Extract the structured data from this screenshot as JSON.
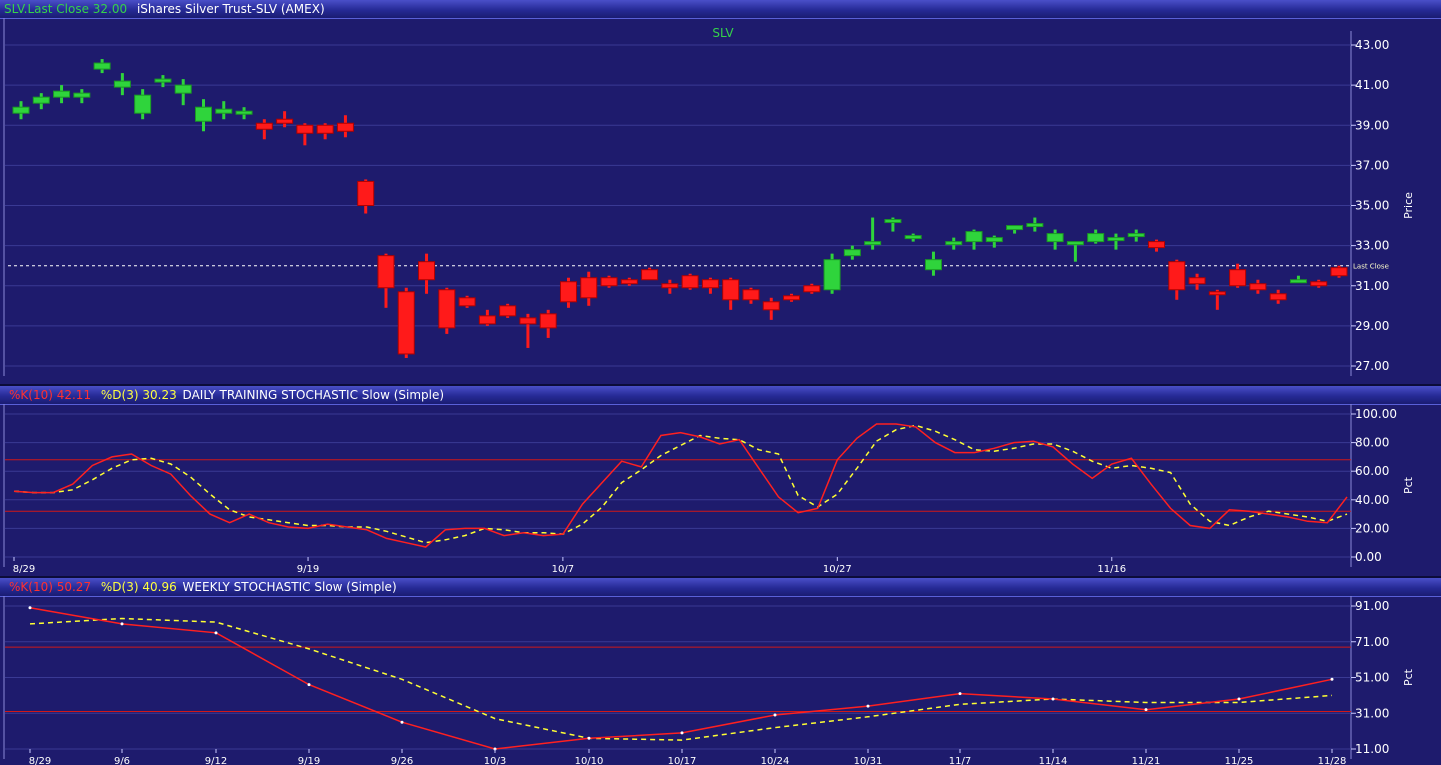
{
  "price_header": {
    "symbol_label": "SLV.Last Close 32.00",
    "description": "iShares Silver Trust-SLV (AMEX)"
  },
  "daily_header": {
    "k_label": "%K(10) 42.11",
    "d_label": "%D(3) 30.23",
    "study": "DAILY TRAINING STOCHASTIC Slow (Simple)"
  },
  "weekly_header": {
    "k_label": "%K(10) 50.27",
    "d_label": "%D(3) 40.96",
    "study": "WEEKLY STOCHASTIC Slow (Simple)"
  },
  "colors": {
    "up": "#2fd43c",
    "down": "#ff1a1a",
    "k_line": "#ff2020",
    "d_line": "#ffff33",
    "grid": "#3a3a94",
    "background": "#1e1b6d",
    "axis_text": "#ffffff"
  },
  "chart_data": [
    {
      "type": "candlestick",
      "title": "SLV",
      "ylabel": "Price",
      "ylim": [
        27,
        44
      ],
      "yticks": [
        "43.00",
        "41.00",
        "39.00",
        "37.00",
        "35.00",
        "33.00",
        "31.00",
        "29.00",
        "27.00"
      ],
      "last_close": {
        "value": 32.0,
        "label": "Last Close"
      },
      "candles": [
        {
          "o": 39.6,
          "h": 40.2,
          "l": 39.3,
          "c": 39.9
        },
        {
          "o": 40.1,
          "h": 40.6,
          "l": 39.8,
          "c": 40.4
        },
        {
          "o": 40.4,
          "h": 41.0,
          "l": 40.1,
          "c": 40.7
        },
        {
          "o": 40.4,
          "h": 40.8,
          "l": 40.1,
          "c": 40.6
        },
        {
          "o": 41.8,
          "h": 42.3,
          "l": 41.6,
          "c": 42.1
        },
        {
          "o": 40.9,
          "h": 41.6,
          "l": 40.5,
          "c": 41.2
        },
        {
          "o": 39.6,
          "h": 40.8,
          "l": 39.3,
          "c": 40.5
        },
        {
          "o": 41.2,
          "h": 41.5,
          "l": 40.9,
          "c": 41.3
        },
        {
          "o": 40.6,
          "h": 41.3,
          "l": 40.0,
          "c": 41.0
        },
        {
          "o": 39.2,
          "h": 40.3,
          "l": 38.7,
          "c": 39.9
        },
        {
          "o": 39.6,
          "h": 40.2,
          "l": 39.3,
          "c": 39.8
        },
        {
          "o": 39.6,
          "h": 39.9,
          "l": 39.3,
          "c": 39.7
        },
        {
          "o": 39.1,
          "h": 39.3,
          "l": 38.3,
          "c": 38.8
        },
        {
          "o": 39.3,
          "h": 39.7,
          "l": 38.9,
          "c": 39.1
        },
        {
          "o": 39.0,
          "h": 39.1,
          "l": 38.0,
          "c": 38.6
        },
        {
          "o": 39.0,
          "h": 39.1,
          "l": 38.3,
          "c": 38.6
        },
        {
          "o": 39.1,
          "h": 39.5,
          "l": 38.4,
          "c": 38.7
        },
        {
          "o": 36.2,
          "h": 36.3,
          "l": 34.6,
          "c": 35.0
        },
        {
          "o": 32.5,
          "h": 32.6,
          "l": 29.9,
          "c": 30.9
        },
        {
          "o": 30.7,
          "h": 30.9,
          "l": 27.4,
          "c": 27.6
        },
        {
          "o": 32.2,
          "h": 32.6,
          "l": 30.6,
          "c": 31.3
        },
        {
          "o": 30.8,
          "h": 30.9,
          "l": 28.6,
          "c": 28.9
        },
        {
          "o": 30.4,
          "h": 30.5,
          "l": 29.9,
          "c": 30.0
        },
        {
          "o": 29.5,
          "h": 29.8,
          "l": 29.0,
          "c": 29.1
        },
        {
          "o": 30.0,
          "h": 30.1,
          "l": 29.4,
          "c": 29.5
        },
        {
          "o": 29.4,
          "h": 29.6,
          "l": 27.9,
          "c": 29.1
        },
        {
          "o": 29.6,
          "h": 29.8,
          "l": 28.4,
          "c": 28.9
        },
        {
          "o": 31.2,
          "h": 31.4,
          "l": 29.9,
          "c": 30.2
        },
        {
          "o": 31.4,
          "h": 31.7,
          "l": 30.0,
          "c": 30.4
        },
        {
          "o": 31.4,
          "h": 31.5,
          "l": 30.9,
          "c": 31.0
        },
        {
          "o": 31.3,
          "h": 31.4,
          "l": 31.0,
          "c": 31.1
        },
        {
          "o": 31.8,
          "h": 31.9,
          "l": 31.3,
          "c": 31.3
        },
        {
          "o": 31.1,
          "h": 31.3,
          "l": 30.6,
          "c": 30.9
        },
        {
          "o": 31.5,
          "h": 31.6,
          "l": 30.8,
          "c": 30.9
        },
        {
          "o": 31.3,
          "h": 31.4,
          "l": 30.6,
          "c": 30.9
        },
        {
          "o": 31.3,
          "h": 31.4,
          "l": 29.8,
          "c": 30.3
        },
        {
          "o": 30.8,
          "h": 30.9,
          "l": 30.1,
          "c": 30.3
        },
        {
          "o": 30.2,
          "h": 30.4,
          "l": 29.3,
          "c": 29.8
        },
        {
          "o": 30.5,
          "h": 30.6,
          "l": 30.2,
          "c": 30.3
        },
        {
          "o": 31.0,
          "h": 31.1,
          "l": 30.6,
          "c": 30.7
        },
        {
          "o": 30.8,
          "h": 32.6,
          "l": 30.6,
          "c": 32.3
        },
        {
          "o": 32.5,
          "h": 33.0,
          "l": 32.3,
          "c": 32.8
        },
        {
          "o": 33.1,
          "h": 34.4,
          "l": 32.8,
          "c": 33.2
        },
        {
          "o": 34.2,
          "h": 34.4,
          "l": 33.7,
          "c": 34.3
        },
        {
          "o": 33.4,
          "h": 33.6,
          "l": 33.2,
          "c": 33.5
        },
        {
          "o": 31.8,
          "h": 32.7,
          "l": 31.5,
          "c": 32.3
        },
        {
          "o": 33.1,
          "h": 33.4,
          "l": 32.8,
          "c": 33.2
        },
        {
          "o": 33.2,
          "h": 33.8,
          "l": 32.8,
          "c": 33.7
        },
        {
          "o": 33.2,
          "h": 33.5,
          "l": 32.9,
          "c": 33.4
        },
        {
          "o": 33.8,
          "h": 34.0,
          "l": 33.6,
          "c": 34.0
        },
        {
          "o": 34.0,
          "h": 34.4,
          "l": 33.7,
          "c": 34.1
        },
        {
          "o": 33.2,
          "h": 33.8,
          "l": 32.8,
          "c": 33.6
        },
        {
          "o": 33.1,
          "h": 33.2,
          "l": 32.2,
          "c": 33.2
        },
        {
          "o": 33.2,
          "h": 33.8,
          "l": 33.1,
          "c": 33.6
        },
        {
          "o": 33.3,
          "h": 33.6,
          "l": 32.8,
          "c": 33.4
        },
        {
          "o": 33.5,
          "h": 33.8,
          "l": 33.2,
          "c": 33.6
        },
        {
          "o": 33.2,
          "h": 33.3,
          "l": 32.7,
          "c": 32.9
        },
        {
          "o": 32.2,
          "h": 32.3,
          "l": 30.3,
          "c": 30.8
        },
        {
          "o": 31.4,
          "h": 31.6,
          "l": 30.8,
          "c": 31.1
        },
        {
          "o": 30.7,
          "h": 30.8,
          "l": 29.8,
          "c": 30.6
        },
        {
          "o": 31.8,
          "h": 32.1,
          "l": 30.9,
          "c": 31.0
        },
        {
          "o": 31.1,
          "h": 31.3,
          "l": 30.6,
          "c": 30.8
        },
        {
          "o": 30.6,
          "h": 30.8,
          "l": 30.1,
          "c": 30.3
        },
        {
          "o": 31.3,
          "h": 31.5,
          "l": 31.2,
          "c": 31.3
        },
        {
          "o": 31.2,
          "h": 31.3,
          "l": 30.9,
          "c": 31.0
        },
        {
          "o": 31.9,
          "h": 32.0,
          "l": 31.4,
          "c": 31.5
        }
      ]
    },
    {
      "type": "line",
      "ylabel": "Pct",
      "ylim": [
        0,
        100
      ],
      "yticks": [
        "100.00",
        "80.00",
        "60.00",
        "40.00",
        "20.00",
        "0.00"
      ],
      "hlines": [
        68,
        32
      ],
      "x_tick_labels": [
        {
          "i": 0,
          "label": "8/29"
        },
        {
          "i": 15,
          "label": "9/19"
        },
        {
          "i": 28,
          "label": "10/7"
        },
        {
          "i": 42,
          "label": "10/27"
        },
        {
          "i": 56,
          "label": "11/16"
        }
      ],
      "series": [
        {
          "name": "%K(10)",
          "values": [
            46,
            45,
            45,
            51,
            64,
            70,
            72,
            64,
            58,
            43,
            30,
            24,
            30,
            24,
            21,
            20,
            23,
            21,
            19,
            13,
            10,
            7,
            19,
            20,
            20,
            15,
            17,
            15,
            16,
            37,
            52,
            67,
            63,
            85,
            87,
            84,
            79,
            82,
            62,
            42,
            31,
            34,
            68,
            83,
            93,
            93,
            91,
            80,
            73,
            73,
            76,
            80,
            81,
            77,
            65,
            55,
            65,
            69,
            51,
            34,
            22,
            20,
            33,
            32,
            30,
            28,
            25,
            24,
            42
          ]
        },
        {
          "name": "%D(3)",
          "values": [
            46,
            45,
            45,
            47,
            54,
            62,
            68,
            69,
            65,
            56,
            44,
            33,
            28,
            26,
            24,
            22,
            22,
            21,
            21,
            18,
            14,
            10,
            12,
            15,
            20,
            19,
            17,
            17,
            16,
            23,
            35,
            52,
            61,
            71,
            78,
            85,
            83,
            82,
            75,
            72,
            43,
            35,
            44,
            62,
            81,
            89,
            92,
            88,
            82,
            75,
            74,
            76,
            79,
            79,
            74,
            67,
            62,
            64,
            62,
            59,
            37,
            25,
            22,
            28,
            32,
            30,
            28,
            25,
            30
          ]
        }
      ]
    },
    {
      "type": "line",
      "ylabel": "Pct",
      "ylim": [
        11,
        91
      ],
      "yticks": [
        "91.00",
        "71.00",
        "51.00",
        "31.00",
        "11.00"
      ],
      "hlines": [
        68,
        32
      ],
      "categories": [
        "8/29",
        "9/6",
        "9/12",
        "9/19",
        "9/26",
        "10/3",
        "10/10",
        "10/17",
        "10/24",
        "10/31",
        "11/7",
        "11/14",
        "11/21",
        "11/25",
        "11/28"
      ],
      "series": [
        {
          "name": "%K(10)",
          "values": [
            90,
            81,
            76,
            47,
            26,
            11,
            17,
            20,
            30,
            35,
            42,
            39,
            33,
            39,
            50
          ]
        },
        {
          "name": "%D(3)",
          "values": [
            81,
            84,
            82,
            67,
            50,
            28,
            17,
            16,
            23,
            29,
            36,
            39,
            37,
            37,
            41
          ]
        }
      ]
    }
  ]
}
